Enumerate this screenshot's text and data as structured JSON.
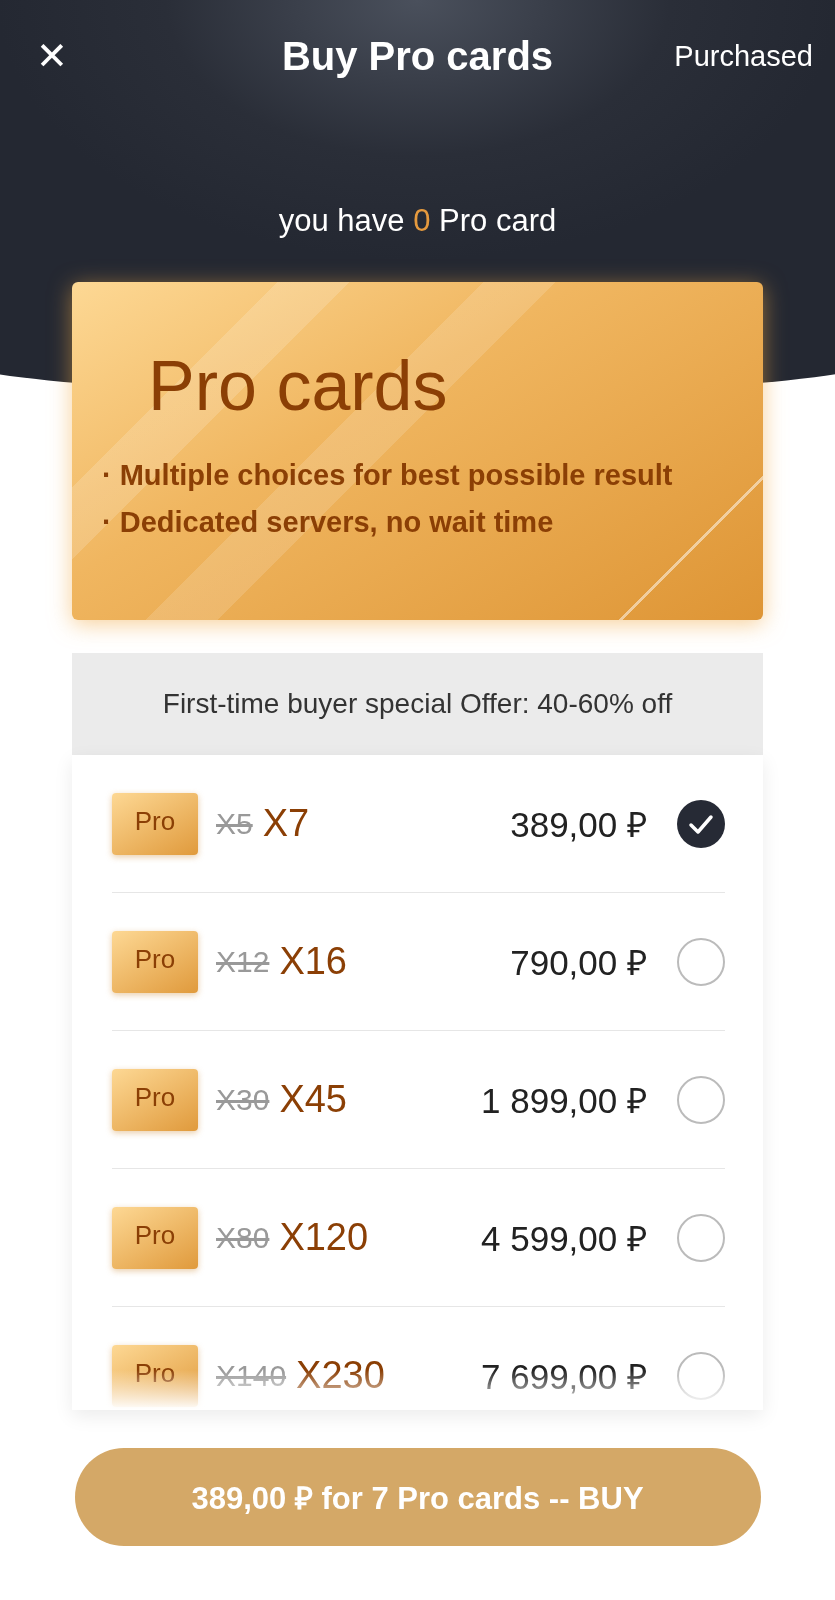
{
  "top_bar": {
    "close": "✕",
    "title": "Buy Pro cards",
    "purchased": "Purchased"
  },
  "balance": {
    "prefix": "you have",
    "count": "0",
    "suffix": "Pro card"
  },
  "promo_card": {
    "title": "Pro cards",
    "bullets": [
      "· Multiple choices for best possible result",
      "· Dedicated servers, no wait time"
    ]
  },
  "offer_banner": "First-time buyer special Offer: 40-60% off",
  "packages": [
    {
      "badge": "Pro",
      "old_count": "X5",
      "count": "X7",
      "price": "389,00 ₽",
      "selected": true
    },
    {
      "badge": "Pro",
      "old_count": "X12",
      "count": "X16",
      "price": "790,00 ₽",
      "selected": false
    },
    {
      "badge": "Pro",
      "old_count": "X30",
      "count": "X45",
      "price": "1 899,00 ₽",
      "selected": false
    },
    {
      "badge": "Pro",
      "old_count": "X80",
      "count": "X120",
      "price": "4 599,00 ₽",
      "selected": false
    },
    {
      "badge": "Pro",
      "old_count": "X140",
      "count": "X230",
      "price": "7 699,00 ₽",
      "selected": false
    }
  ],
  "buy_button": "389,00 ₽ for 7 Pro cards -- BUY"
}
